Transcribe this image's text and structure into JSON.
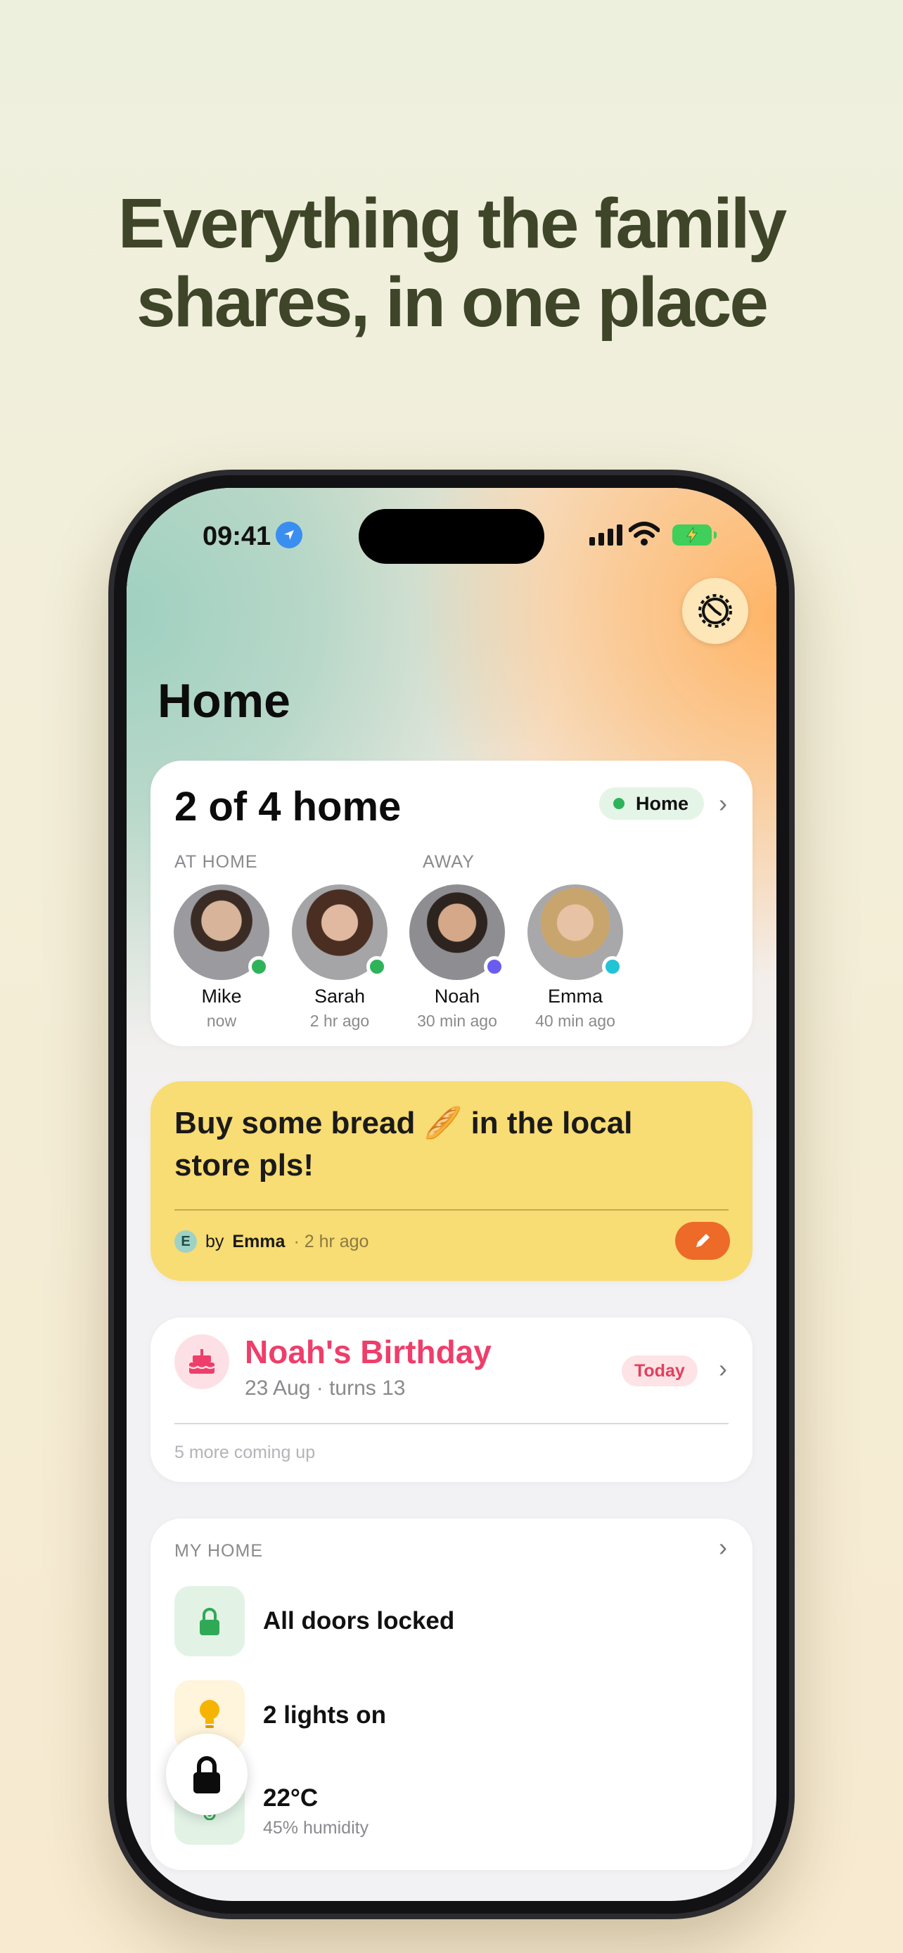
{
  "headline": [
    "Everything the family",
    "shares, in one place"
  ],
  "status_bar": {
    "time": "09:41"
  },
  "page_title": "Home",
  "family": {
    "summary": "2 of 4 home",
    "status_pill": "Home",
    "at_home_label": "AT HOME",
    "away_label": "AWAY",
    "members": [
      {
        "name": "Mike",
        "time": "now",
        "status_color": "#2fb35a",
        "avatar_color": "#6d6a66"
      },
      {
        "name": "Sarah",
        "time": "2 hr ago",
        "status_color": "#2fb35a",
        "avatar_color": "#8a6f62"
      },
      {
        "name": "Noah",
        "time": "30 min ago",
        "status_color": "#6b5cf0",
        "avatar_color": "#5f5a57"
      },
      {
        "name": "Emma",
        "time": "40 min ago",
        "status_color": "#22c3d6",
        "avatar_color": "#c9b08c"
      }
    ]
  },
  "note": {
    "text": "Buy some bread 🥖 in the local store pls!",
    "author_initial": "E",
    "by": "by",
    "author": "Emma",
    "time": "· 2 hr ago"
  },
  "birthday": {
    "title": "Noah's Birthday",
    "subtitle": "23 Aug · turns 13",
    "badge": "Today",
    "more": "5 more coming up"
  },
  "my_home": {
    "label": "MY HOME",
    "rows": [
      {
        "label": "All doors locked",
        "icon": "lock-icon"
      },
      {
        "label": "2 lights on",
        "icon": "bulb-icon"
      },
      {
        "label": "22°C",
        "sub": "45% humidity",
        "icon": "thermometer-icon"
      }
    ]
  },
  "colors": {
    "accent_orange": "#ee6a28",
    "note_yellow": "#f8dc74",
    "birthday_pink": "#ee3e6a",
    "home_green": "#2fb35a"
  }
}
